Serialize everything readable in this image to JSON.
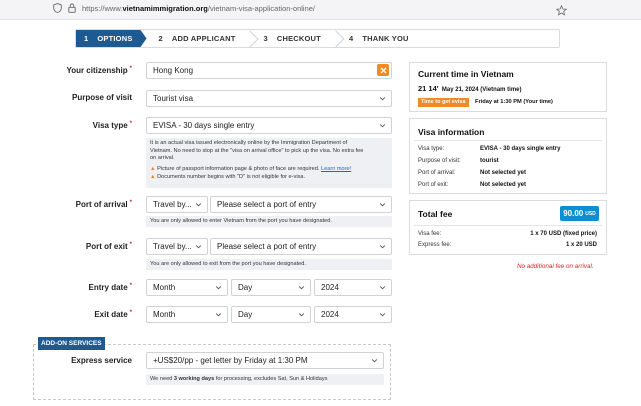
{
  "browser": {
    "url_prefix": "https://www.",
    "url_domain": "vietnamimmigration.org",
    "url_path": "/vietnam-visa-application-online/"
  },
  "steps": [
    {
      "num": "1",
      "label": "OPTIONS"
    },
    {
      "num": "2",
      "label": "ADD APPLICANT"
    },
    {
      "num": "3",
      "label": "CHECKOUT"
    },
    {
      "num": "4",
      "label": "THANK YOU"
    }
  ],
  "form": {
    "citizenship_label": "Your citizenship",
    "citizenship_value": "Hong Kong",
    "purpose_label": "Purpose of visit",
    "purpose_value": "Tourist visa",
    "visa_type_label": "Visa type",
    "visa_type_value": "EVISA - 30 days single entry",
    "visa_note_1": "It is an actual visa issued electronically online by the Immigration Department of",
    "visa_note_2": "Vietnam. No need to stop at the \"visa on arrival office\" to pick up the visa. No extra fee",
    "visa_note_3": "on arrival.",
    "visa_warn_1": "Picture of passport information page & photo of face are required.",
    "visa_warn_link": "Learn more!",
    "visa_warn_2": "Documents number begins with \"D\" is not eligible for e-visa.",
    "arrival_label": "Port of arrival",
    "arrival_type": "Travel by...",
    "arrival_port": "Please select a port of entry",
    "arrival_note": "You are only allowed to enter Vietnam from the port you have designated.",
    "exit_label": "Port of exit",
    "exit_type": "Travel by...",
    "exit_port": "Please select a port of entry",
    "exit_note": "You are only allowed to exit from the port you have designated.",
    "entry_label": "Entry date",
    "exit_date_label": "Exit date",
    "month": "Month",
    "day": "Day",
    "year": "2024"
  },
  "addon": {
    "tag": "ADD-ON SERVICES",
    "express_label": "Express service",
    "express_value": "+US$20/pp - get letter by Friday at 1:30 PM",
    "express_note_pre": "We need ",
    "express_note_bold": "3 working days",
    "express_note_post": " for processing, excludes Sat, Sun & Holidays"
  },
  "time_panel": {
    "title": "Current time in Vietnam",
    "time": "21 14'",
    "date": "May 21, 2024 (Vietnam time)",
    "badge": "Time to get evisa",
    "badge_note": "Friday at 1:30 PM (Your time)"
  },
  "visa_info": {
    "title": "Visa information",
    "rows": [
      {
        "k": "Visa type:",
        "v": "EVISA - 30 days single entry"
      },
      {
        "k": "Purpose of visit:",
        "v": "tourist"
      },
      {
        "k": "Port of arrival:",
        "v": "Not selected yet"
      },
      {
        "k": "Port of exit:",
        "v": "Not selected yet"
      }
    ]
  },
  "fees": {
    "title": "Total fee",
    "total": "90.00",
    "currency": "USD",
    "visa_fee_label": "Visa fee:",
    "visa_fee_value": "1 x 70 USD (fixed price)",
    "express_fee_label": "Express fee:",
    "express_fee_value": "1 x 20 USD",
    "no_additional": "No additional fee on arrival."
  },
  "colors": {
    "primary": "#1d5a91",
    "accent_orange": "#f08a24",
    "fee_blue": "#0c8ed0",
    "required_red": "#d9252a"
  }
}
